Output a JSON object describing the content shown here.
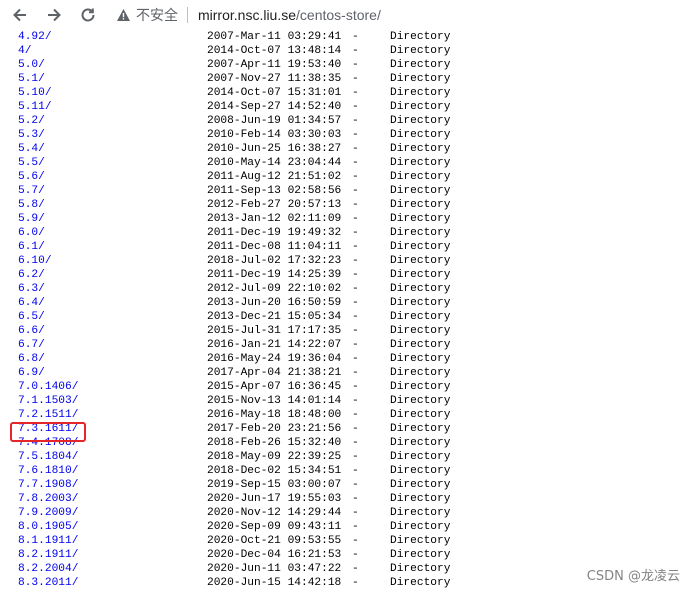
{
  "browser": {
    "security_label": "不安全",
    "url_host": "mirror.nsc.liu.se",
    "url_path": "/centos-store/"
  },
  "listing": [
    {
      "name": "4.92/",
      "date": "2007-Mar-11 03:29:41",
      "size": "-",
      "type": "Directory"
    },
    {
      "name": "4/",
      "date": "2014-Oct-07 13:48:14",
      "size": "-",
      "type": "Directory"
    },
    {
      "name": "5.0/",
      "date": "2007-Apr-11 19:53:40",
      "size": "-",
      "type": "Directory"
    },
    {
      "name": "5.1/",
      "date": "2007-Nov-27 11:38:35",
      "size": "-",
      "type": "Directory"
    },
    {
      "name": "5.10/",
      "date": "2014-Oct-07 15:31:01",
      "size": "-",
      "type": "Directory"
    },
    {
      "name": "5.11/",
      "date": "2014-Sep-27 14:52:40",
      "size": "-",
      "type": "Directory"
    },
    {
      "name": "5.2/",
      "date": "2008-Jun-19 01:34:57",
      "size": "-",
      "type": "Directory"
    },
    {
      "name": "5.3/",
      "date": "2010-Feb-14 03:30:03",
      "size": "-",
      "type": "Directory"
    },
    {
      "name": "5.4/",
      "date": "2010-Jun-25 16:38:27",
      "size": "-",
      "type": "Directory"
    },
    {
      "name": "5.5/",
      "date": "2010-May-14 23:04:44",
      "size": "-",
      "type": "Directory"
    },
    {
      "name": "5.6/",
      "date": "2011-Aug-12 21:51:02",
      "size": "-",
      "type": "Directory"
    },
    {
      "name": "5.7/",
      "date": "2011-Sep-13 02:58:56",
      "size": "-",
      "type": "Directory"
    },
    {
      "name": "5.8/",
      "date": "2012-Feb-27 20:57:13",
      "size": "-",
      "type": "Directory"
    },
    {
      "name": "5.9/",
      "date": "2013-Jan-12 02:11:09",
      "size": "-",
      "type": "Directory"
    },
    {
      "name": "6.0/",
      "date": "2011-Dec-19 19:49:32",
      "size": "-",
      "type": "Directory"
    },
    {
      "name": "6.1/",
      "date": "2011-Dec-08 11:04:11",
      "size": "-",
      "type": "Directory"
    },
    {
      "name": "6.10/",
      "date": "2018-Jul-02 17:32:23",
      "size": "-",
      "type": "Directory"
    },
    {
      "name": "6.2/",
      "date": "2011-Dec-19 14:25:39",
      "size": "-",
      "type": "Directory"
    },
    {
      "name": "6.3/",
      "date": "2012-Jul-09 22:10:02",
      "size": "-",
      "type": "Directory"
    },
    {
      "name": "6.4/",
      "date": "2013-Jun-20 16:50:59",
      "size": "-",
      "type": "Directory"
    },
    {
      "name": "6.5/",
      "date": "2013-Dec-21 15:05:34",
      "size": "-",
      "type": "Directory"
    },
    {
      "name": "6.6/",
      "date": "2015-Jul-31 17:17:35",
      "size": "-",
      "type": "Directory"
    },
    {
      "name": "6.7/",
      "date": "2016-Jan-21 14:22:07",
      "size": "-",
      "type": "Directory"
    },
    {
      "name": "6.8/",
      "date": "2016-May-24 19:36:04",
      "size": "-",
      "type": "Directory"
    },
    {
      "name": "6.9/",
      "date": "2017-Apr-04 21:38:21",
      "size": "-",
      "type": "Directory"
    },
    {
      "name": "7.0.1406/",
      "date": "2015-Apr-07 16:36:45",
      "size": "-",
      "type": "Directory"
    },
    {
      "name": "7.1.1503/",
      "date": "2015-Nov-13 14:01:14",
      "size": "-",
      "type": "Directory"
    },
    {
      "name": "7.2.1511/",
      "date": "2016-May-18 18:48:00",
      "size": "-",
      "type": "Directory"
    },
    {
      "name": "7.3.1611/",
      "date": "2017-Feb-20 23:21:56",
      "size": "-",
      "type": "Directory"
    },
    {
      "name": "7.4.1708/",
      "date": "2018-Feb-26 15:32:40",
      "size": "-",
      "type": "Directory"
    },
    {
      "name": "7.5.1804/",
      "date": "2018-May-09 22:39:25",
      "size": "-",
      "type": "Directory"
    },
    {
      "name": "7.6.1810/",
      "date": "2018-Dec-02 15:34:51",
      "size": "-",
      "type": "Directory"
    },
    {
      "name": "7.7.1908/",
      "date": "2019-Sep-15 03:00:07",
      "size": "-",
      "type": "Directory"
    },
    {
      "name": "7.8.2003/",
      "date": "2020-Jun-17 19:55:03",
      "size": "-",
      "type": "Directory"
    },
    {
      "name": "7.9.2009/",
      "date": "2020-Nov-12 14:29:44",
      "size": "-",
      "type": "Directory"
    },
    {
      "name": "8.0.1905/",
      "date": "2020-Sep-09 09:43:11",
      "size": "-",
      "type": "Directory"
    },
    {
      "name": "8.1.1911/",
      "date": "2020-Oct-21 09:53:55",
      "size": "-",
      "type": "Directory"
    },
    {
      "name": "8.2.1911/",
      "date": "2020-Dec-04 16:21:53",
      "size": "-",
      "type": "Directory"
    },
    {
      "name": "8.2.2004/",
      "date": "2020-Jun-11 03:47:22",
      "size": "-",
      "type": "Directory"
    },
    {
      "name": "8.3.2011/",
      "date": "2020-Jun-15 14:42:18",
      "size": "-",
      "type": "Directory"
    }
  ],
  "highlighted_row": "7.3.1611/",
  "watermark": "CSDN @龙凌云",
  "colors": {
    "link": "#0000ee",
    "highlight": "#e5252a"
  }
}
